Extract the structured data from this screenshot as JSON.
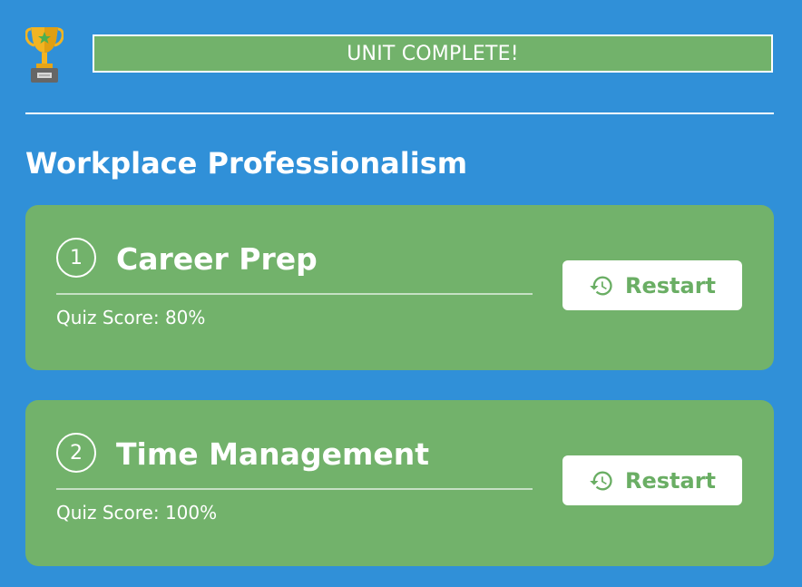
{
  "header": {
    "trophy_icon": "trophy-icon",
    "banner_text": "UNIT COMPLETE!"
  },
  "unit": {
    "title": "Workplace Professionalism"
  },
  "lessons": [
    {
      "number": "1",
      "title": "Career Prep",
      "quiz_score": "Quiz Score: 80%",
      "restart_label": "Restart"
    },
    {
      "number": "2",
      "title": "Time Management",
      "quiz_score": "Quiz Score: 100%",
      "restart_label": "Restart"
    }
  ],
  "colors": {
    "background": "#3090d8",
    "card": "#72b26b",
    "button_text": "#6aae64",
    "trophy_gold": "#f2b422",
    "trophy_base": "#666666"
  },
  "icons": {
    "restart": "history-icon",
    "star": "star-icon"
  }
}
